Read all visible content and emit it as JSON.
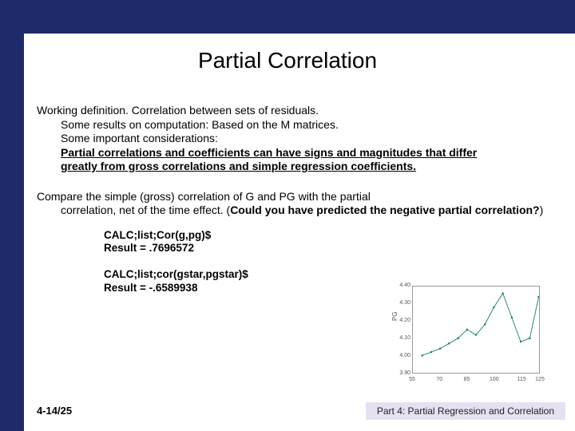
{
  "title": "Partial Correlation",
  "para1": {
    "l1": "Working definition.  Correlation between sets of residuals.",
    "l2": "Some results on computation:  Based on the M matrices.",
    "l3": "Some important considerations:",
    "l4": "Partial correlations and coefficients  can have signs and magnitudes that differ greatly from gross correlations and simple regression coefficients."
  },
  "para2": {
    "l1": "Compare the simple (gross) correlation of G and PG with the partial",
    "l2a": "correlation, net of the time effect.  (",
    "l2b": "Could you have predicted the negative partial correlation?",
    "l2c": ")"
  },
  "calc1": {
    "cmd": "CALC;list;Cor(g,pg)$",
    "res": "Result  =  .7696572"
  },
  "calc2": {
    "cmd": "CALC;list;cor(gstar,pgstar)$",
    "res": "Result  = -.6589938"
  },
  "pagefoot": "4-14/25",
  "partfoot": "Part 4: Partial Regression and Correlation",
  "chart_data": {
    "type": "line",
    "ylabel": "PG",
    "xlabel": "",
    "x": [
      60,
      65,
      70,
      75,
      80,
      85,
      90,
      95,
      100,
      105,
      110,
      115,
      120,
      125
    ],
    "y": [
      4.0,
      4.02,
      4.04,
      4.07,
      4.1,
      4.15,
      4.12,
      4.18,
      4.28,
      4.36,
      4.22,
      4.08,
      4.1,
      4.34
    ],
    "xlim": [
      55,
      125
    ],
    "ylim": [
      3.9,
      4.4
    ],
    "yticks": [
      3.9,
      4.0,
      4.1,
      4.2,
      4.3,
      4.4
    ],
    "xticks": [
      55,
      70,
      85,
      100,
      115,
      125
    ]
  }
}
